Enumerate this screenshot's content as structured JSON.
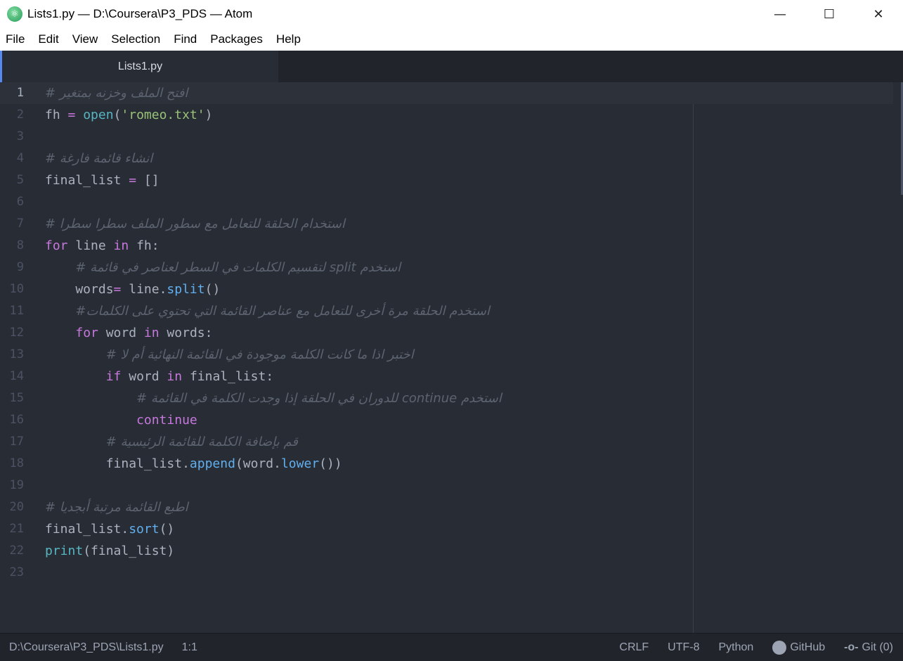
{
  "window": {
    "title": "Lists1.py — D:\\Coursera\\P3_PDS — Atom",
    "minimize": "—",
    "maximize": "☐",
    "close": "✕"
  },
  "menu": [
    {
      "u": "F",
      "rest": "ile"
    },
    {
      "u": "E",
      "rest": "dit"
    },
    {
      "u": "V",
      "rest": "iew"
    },
    {
      "u": "S",
      "rest": "election"
    },
    {
      "u": "F",
      "rest": "ind",
      "pre": ""
    },
    {
      "u": "P",
      "rest": "ackages"
    },
    {
      "u": "H",
      "rest": "elp"
    }
  ],
  "menu_labels": [
    "File",
    "Edit",
    "View",
    "Selection",
    "Find",
    "Packages",
    "Help"
  ],
  "tab": {
    "label": "Lists1.py"
  },
  "code": [
    [
      [
        "",
        "",
        ""
      ],
      [
        "cm",
        "افتح الملف وخزنه بمتغير #"
      ]
    ],
    [
      [
        "",
        "fh "
      ],
      [
        "op",
        "="
      ],
      [
        "",
        " "
      ],
      [
        "bi",
        "open"
      ],
      [
        "",
        "("
      ],
      [
        "str",
        "'romeo.txt'"
      ],
      [
        "",
        ")"
      ]
    ],
    [],
    [
      [
        "cm",
        "انشاء قائمة فارغة #"
      ]
    ],
    [
      [
        "",
        "final_list "
      ],
      [
        "op",
        "="
      ],
      [
        "",
        " []"
      ]
    ],
    [],
    [
      [
        "cm",
        "استخدام الحلقة للتعامل مع سطور الملف سطرا سطرا #"
      ]
    ],
    [
      [
        "kw",
        "for"
      ],
      [
        "",
        " line "
      ],
      [
        "kw",
        "in"
      ],
      [
        "",
        " fh:"
      ]
    ],
    [
      [
        "",
        "    "
      ],
      [
        "cm",
        "استخدم split لتقسيم الكلمات في السطر لعناصر في قائمة #"
      ]
    ],
    [
      [
        "",
        "    words"
      ],
      [
        "op",
        "="
      ],
      [
        "",
        " line."
      ],
      [
        "fn",
        "split"
      ],
      [
        "",
        "()"
      ]
    ],
    [
      [
        "",
        "    "
      ],
      [
        "cm",
        "استخدم الحلقة مرة أخرى للتعامل مع عناصر القائمة التي تحتوي على الكلمات#"
      ]
    ],
    [
      [
        "",
        "    "
      ],
      [
        "kw",
        "for"
      ],
      [
        "",
        " word "
      ],
      [
        "kw",
        "in"
      ],
      [
        "",
        " words:"
      ]
    ],
    [
      [
        "",
        "        "
      ],
      [
        "cm",
        "اختبر اذا ما كانت الكلمة موجودة في القائمة النهائية أم لا #"
      ]
    ],
    [
      [
        "",
        "        "
      ],
      [
        "kw",
        "if"
      ],
      [
        "",
        " word "
      ],
      [
        "kw",
        "in"
      ],
      [
        "",
        " final_list:"
      ]
    ],
    [
      [
        "",
        "            "
      ],
      [
        "cm",
        "استخدم continue للدوران في الحلقة إذا وجدت الكلمة في القائمة #"
      ]
    ],
    [
      [
        "",
        "            "
      ],
      [
        "kw",
        "continue"
      ]
    ],
    [
      [
        "",
        "        "
      ],
      [
        "cm",
        "قم بإضافة الكلمة للقائمة الرئيسية #"
      ]
    ],
    [
      [
        "",
        "        final_list."
      ],
      [
        "fn",
        "append"
      ],
      [
        "",
        "(word."
      ],
      [
        "fn",
        "lower"
      ],
      [
        "",
        "())"
      ]
    ],
    [],
    [
      [
        "cm",
        "اطبع القائمة مرتبة أبجديا #"
      ]
    ],
    [
      [
        "",
        "final_list."
      ],
      [
        "fn",
        "sort"
      ],
      [
        "",
        "()"
      ]
    ],
    [
      [
        "bi",
        "print"
      ],
      [
        "",
        "(final_list)"
      ]
    ],
    []
  ],
  "status": {
    "path": "D:\\Coursera\\P3_PDS\\Lists1.py",
    "cursor": "1:1",
    "line_ending": "CRLF",
    "encoding": "UTF-8",
    "grammar": "Python",
    "github": "GitHub",
    "git": "Git (0)"
  }
}
